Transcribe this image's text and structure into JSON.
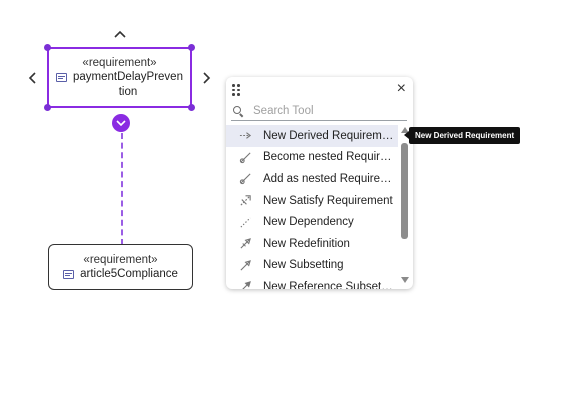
{
  "diagram": {
    "selected_node": {
      "stereotype": "«requirement»",
      "name_line1": "paymentDelayPreven",
      "name_line2": "tion"
    },
    "other_node": {
      "stereotype": "«requirement»",
      "name": "article5Compliance"
    },
    "nav": {
      "up": "^",
      "left": "<",
      "right": ">"
    },
    "expand_glyph": "⌄"
  },
  "palette": {
    "close_glyph": "×",
    "search_placeholder": "Search Tool",
    "tools": [
      {
        "label": "New Derived Requirement",
        "icon": "derive-arrow-icon"
      },
      {
        "label": "Become nested Requirement",
        "icon": "nest-icon"
      },
      {
        "label": "Add as nested Requirement",
        "icon": "nest-icon"
      },
      {
        "label": "New Satisfy Requirement",
        "icon": "satisfy-icon"
      },
      {
        "label": "New Dependency",
        "icon": "dependency-icon"
      },
      {
        "label": "New Redefinition",
        "icon": "redefinition-icon"
      },
      {
        "label": "New Subsetting",
        "icon": "subsetting-icon"
      },
      {
        "label": "New Reference Subsetting",
        "icon": "reference-subsetting-icon"
      }
    ]
  },
  "tooltip": {
    "text": "New Derived Requirement"
  },
  "colors": {
    "accent": "#8a2be2",
    "hover": "#e8eaf4",
    "tooltip_bg": "#111111"
  }
}
